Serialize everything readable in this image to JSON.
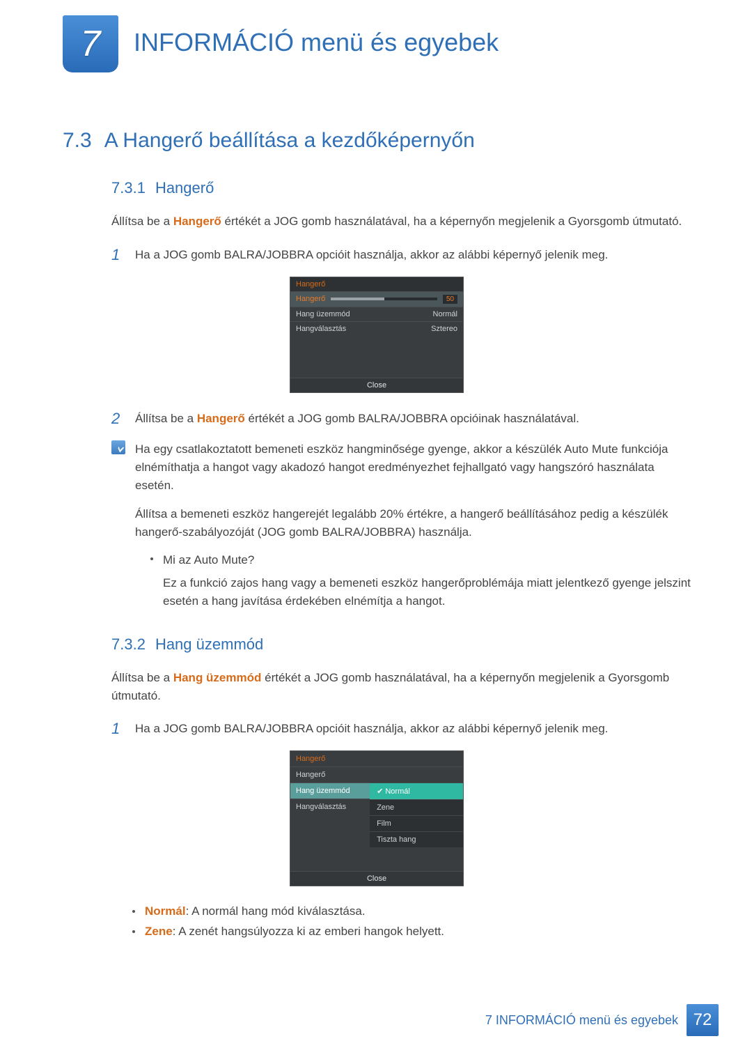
{
  "chapter": {
    "number": "7",
    "title": "INFORMÁCIÓ menü és egyebek"
  },
  "s73": {
    "num": "7.3",
    "title": "A Hangerő beállítása a kezdőképernyőn"
  },
  "s731": {
    "num": "7.3.1",
    "title": "Hangerő",
    "intro_a": "Állítsa be a ",
    "intro_b": "Hangerő",
    "intro_c": " értékét a JOG gomb használatával, ha a képernyőn megjelenik a Gyorsgomb útmutató.",
    "step1num": "1",
    "step1": "Ha a JOG gomb BALRA/JOBBRA opcióit használja, akkor az alábbi képernyő jelenik meg.",
    "osd": {
      "header": "Hangerő",
      "row1_label": "Hangerő",
      "row1_value": "50",
      "row2_label": "Hang üzemmód",
      "row2_value": "Normál",
      "row3_label": "Hangválasztás",
      "row3_value": "Sztereo",
      "close": "Close"
    },
    "step2num": "2",
    "step2_a": "Állítsa be a ",
    "step2_b": "Hangerő",
    "step2_c": " értékét a JOG gomb BALRA/JOBBRA opcióinak használatával.",
    "note_p1": "Ha egy csatlakoztatott bemeneti eszköz hangminősége gyenge, akkor a készülék Auto Mute funkciója elnémíthatja a hangot vagy akadozó hangot eredményezhet fejhallgató vagy hangszóró használata esetén.",
    "note_p2": "Állítsa a bemeneti eszköz hangerejét legalább 20% értékre, a hangerő beállításához pedig a készülék hangerő-szabályozóját (JOG gomb BALRA/JOBBRA) használja.",
    "note_b1": "Mi az Auto Mute?",
    "note_b1_sub": "Ez a funkció zajos hang vagy a bemeneti eszköz hangerőproblémája miatt jelentkező gyenge jelszint esetén a hang javítása érdekében elnémítja a hangot."
  },
  "s732": {
    "num": "7.3.2",
    "title": "Hang üzemmód",
    "intro_a": "Állítsa be a ",
    "intro_b": "Hang üzemmód",
    "intro_c": " értékét a JOG gomb használatával, ha a képernyőn megjelenik a Gyorsgomb útmutató.",
    "step1num": "1",
    "step1": "Ha a JOG gomb BALRA/JOBBRA opcióit használja, akkor az alábbi képernyő jelenik meg.",
    "osd": {
      "header": "Hangerő",
      "left1": "Hangerő",
      "left2": "Hang üzemmód",
      "left3": "Hangválasztás",
      "opt1": "Normál",
      "opt2": "Zene",
      "opt3": "Film",
      "opt4": "Tiszta hang",
      "close": "Close"
    },
    "bullet1_k": "Normál",
    "bullet1_v": ": A normál hang mód kiválasztása.",
    "bullet2_k": "Zene",
    "bullet2_v": ": A zenét hangsúlyozza ki az emberi hangok helyett."
  },
  "footer": {
    "text": "7 INFORMÁCIÓ menü és egyebek",
    "page": "72"
  }
}
